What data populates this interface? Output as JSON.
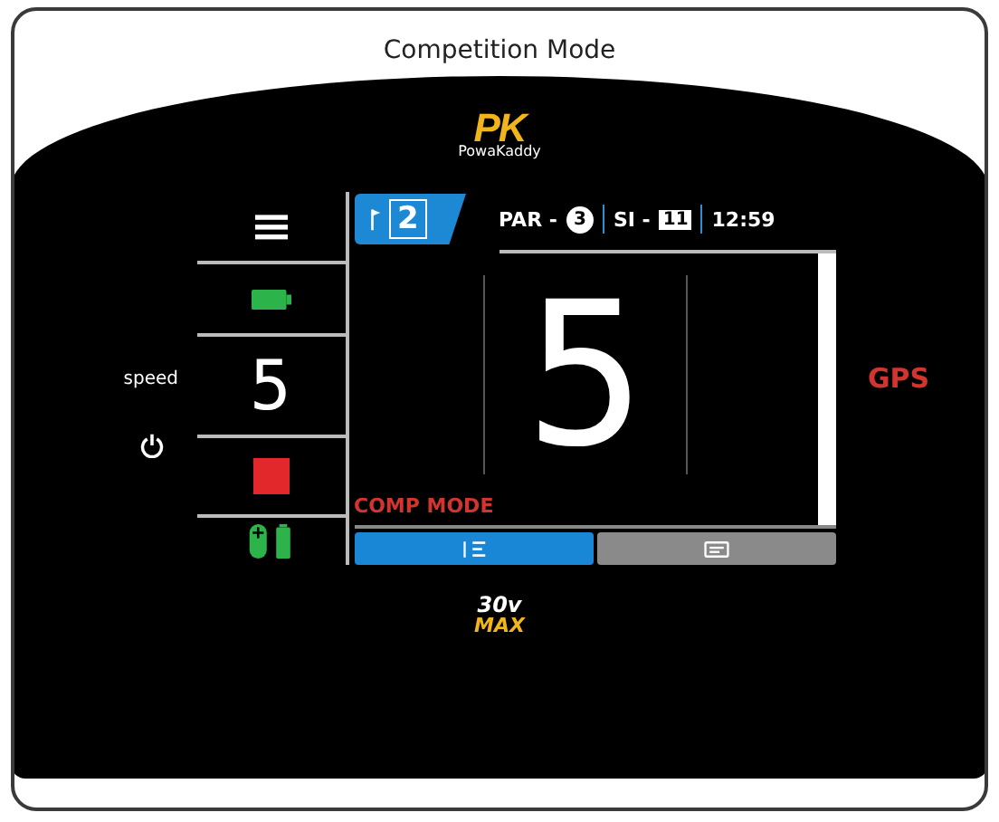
{
  "title": "Competition Mode",
  "logo": {
    "mark": "PK",
    "name": "PowaKaddy"
  },
  "side": {
    "speed_label": "speed",
    "speed_value": "5"
  },
  "hole": {
    "number": "2"
  },
  "info": {
    "par_label": "PAR -",
    "par": "3",
    "si_label": "SI -",
    "si": "11",
    "time": "12:59"
  },
  "main_value": "5",
  "mode_label": "COMP MODE",
  "gps_label": "GPS",
  "bottom_tabs": [
    {
      "kind": "list",
      "selected": true
    },
    {
      "kind": "card",
      "selected": false
    }
  ],
  "footer_logo": {
    "top": "30v",
    "bottom": "MAX"
  }
}
